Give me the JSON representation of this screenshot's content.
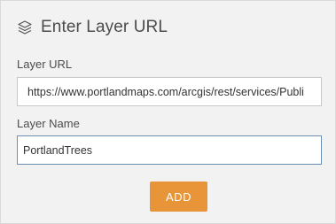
{
  "header": {
    "icon": "layers-icon",
    "title": "Enter Layer URL"
  },
  "form": {
    "url_label": "Layer URL",
    "url_value": "https://www.portlandmaps.com/arcgis/rest/services/Publi",
    "name_label": "Layer Name",
    "name_value": "PortlandTrees",
    "add_label": "ADD"
  },
  "colors": {
    "accent_button": "#e8953a",
    "panel_background": "#f2f2f2",
    "focused_border": "#6b8fb0"
  }
}
